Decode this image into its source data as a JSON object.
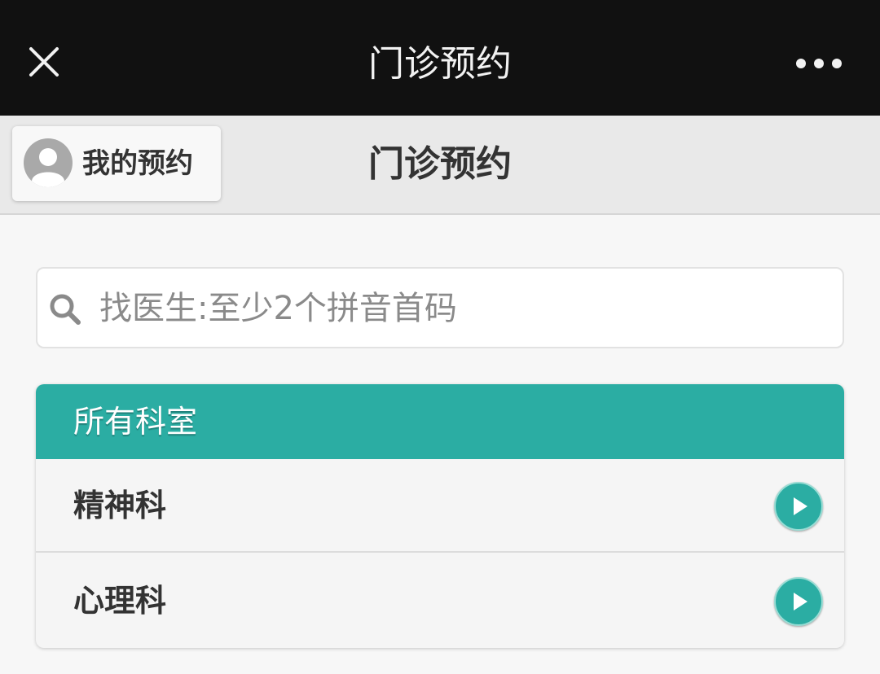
{
  "topbar": {
    "title": "门诊预约",
    "close_icon": "close-icon",
    "more_icon": "more-horizontal-icon"
  },
  "subheader": {
    "my_appointments_label": "我的预约",
    "avatar_icon": "user-avatar-icon",
    "title": "门诊预约"
  },
  "search": {
    "placeholder": "找医生:至少2个拼音首码",
    "value": "",
    "icon": "search-icon"
  },
  "departments": {
    "header": "所有科室",
    "items": [
      {
        "label": "精神科",
        "icon": "play-arrow-icon"
      },
      {
        "label": "心理科",
        "icon": "play-arrow-icon"
      }
    ]
  },
  "colors": {
    "accent": "#2bada3",
    "topbar_bg": "#111111",
    "subheader_bg": "#e9e9e9",
    "page_bg": "#f7f7f7"
  }
}
